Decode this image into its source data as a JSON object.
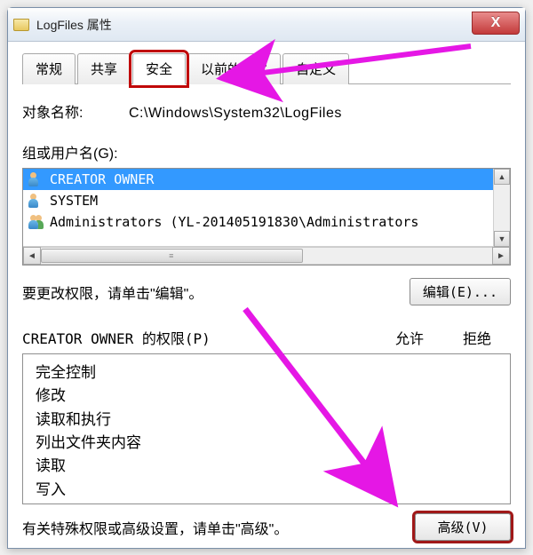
{
  "window": {
    "title": "LogFiles 属性",
    "close_x": "X"
  },
  "tabs": [
    {
      "label": "常规",
      "active": false
    },
    {
      "label": "共享",
      "active": false
    },
    {
      "label": "安全",
      "active": true
    },
    {
      "label": "以前的版本",
      "active": false
    },
    {
      "label": "自定义",
      "active": false
    }
  ],
  "object_name": {
    "label": "对象名称:",
    "value": "C:\\Windows\\System32\\LogFiles"
  },
  "groups": {
    "label": "组或用户名(G):",
    "items": [
      {
        "icon": "user",
        "text": "CREATOR OWNER",
        "selected": true
      },
      {
        "icon": "user",
        "text": "SYSTEM",
        "selected": false
      },
      {
        "icon": "multi",
        "text": "Administrators (YL-201405191830\\Administrators",
        "selected": false
      }
    ]
  },
  "edit": {
    "hint": "要更改权限，请单击\"编辑\"。",
    "button": "编辑(E)..."
  },
  "perm_header": {
    "title": "CREATOR OWNER 的权限(P)",
    "allow": "允许",
    "deny": "拒绝"
  },
  "permissions": [
    "完全控制",
    "修改",
    "读取和执行",
    "列出文件夹内容",
    "读取",
    "写入"
  ],
  "advanced": {
    "hint": "有关特殊权限或高级设置，请单击\"高级\"。",
    "button": "高级(V)"
  },
  "accent_color": "#c00808",
  "arrow_color": "#e517e5"
}
